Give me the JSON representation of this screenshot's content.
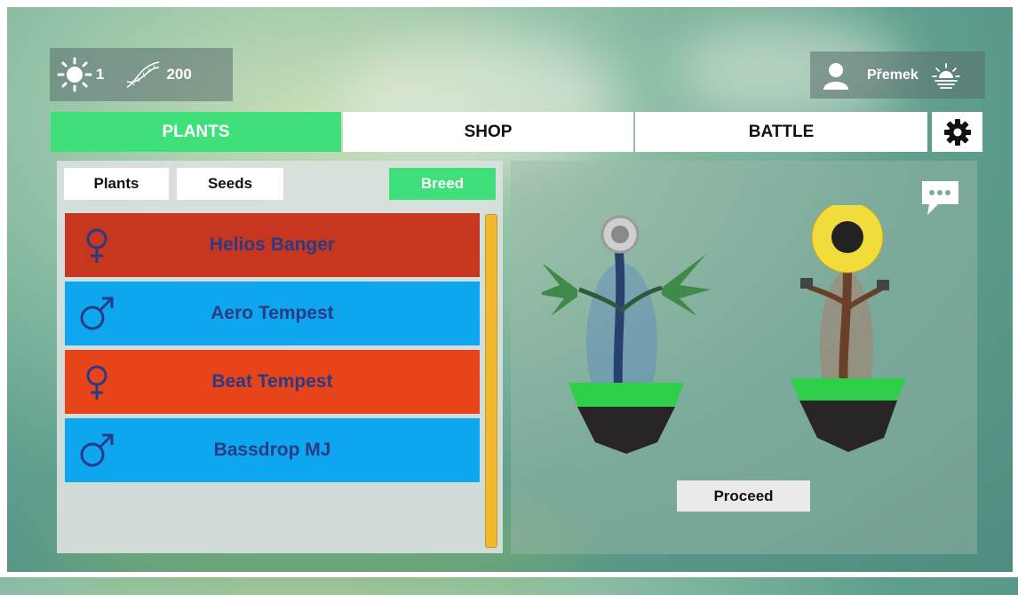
{
  "resources": {
    "sun_value": "1",
    "dna_value": "200",
    "sun_icon": "sun-icon",
    "dna_icon": "dna-icon"
  },
  "user": {
    "name": "Přemek",
    "avatar_icon": "user-icon",
    "status_icon": "sunset-icon"
  },
  "tabs": [
    {
      "label": "PLANTS",
      "active": true
    },
    {
      "label": "SHOP",
      "active": false
    },
    {
      "label": "BATTLE",
      "active": false
    }
  ],
  "subtabs": [
    {
      "label": "Plants",
      "active": false
    },
    {
      "label": "Seeds",
      "active": false
    },
    {
      "label": "Breed",
      "active": true
    }
  ],
  "plants": [
    {
      "name": "Helios Banger",
      "sex": "female",
      "color": "#c7371f"
    },
    {
      "name": "Aero Tempest",
      "sex": "male",
      "color": "#0ea6ef"
    },
    {
      "name": "Beat Tempest",
      "sex": "female",
      "color": "#e84419"
    },
    {
      "name": "Bassdrop MJ",
      "sex": "male",
      "color": "#0ea6ef"
    }
  ],
  "actions": {
    "proceed_label": "Proceed"
  },
  "colors": {
    "accent": "#3fe07a",
    "scrollbar": "#f0b92d",
    "text_blue": "#2a3b86"
  }
}
